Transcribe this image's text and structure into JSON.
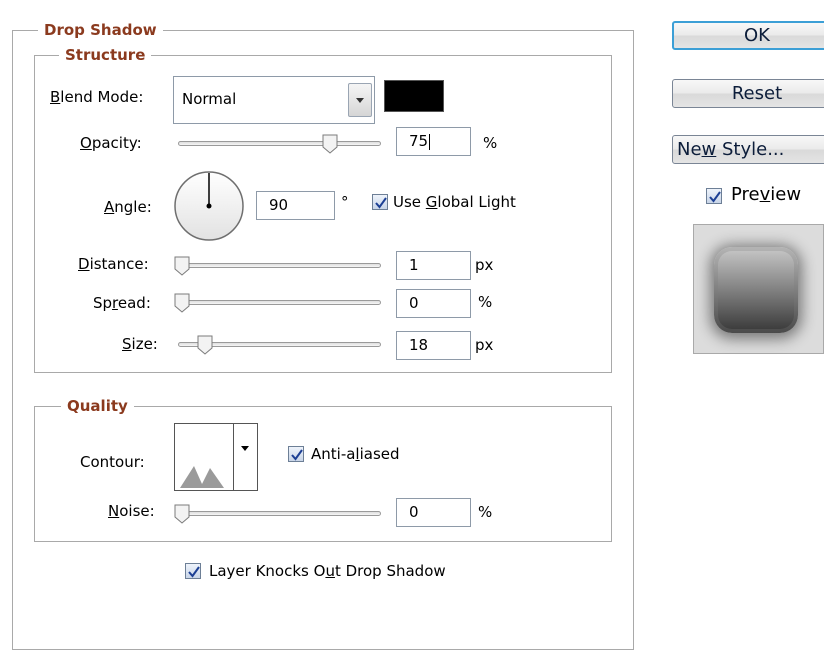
{
  "drop_shadow": {
    "title": "Drop Shadow",
    "structure": {
      "title": "Structure",
      "blend_mode_label": "Blend Mode:",
      "blend_mode_value": "Normal",
      "shadow_color": "#000000",
      "opacity_label": "Opacity:",
      "opacity_value": "75",
      "opacity_unit": "%",
      "opacity_fraction": 0.75,
      "angle_label": "Angle:",
      "angle_value": "90",
      "angle_unit": "°",
      "use_global_light_label": "Use Global Light",
      "use_global_light_checked": true,
      "distance_label": "Distance:",
      "distance_value": "1",
      "distance_unit": "px",
      "spread_label": "Spread:",
      "spread_value": "0",
      "spread_unit": "%",
      "size_label": "Size:",
      "size_value": "18",
      "size_unit": "px"
    },
    "quality": {
      "title": "Quality",
      "contour_label": "Contour:",
      "anti_aliased_label": "Anti-aliased",
      "anti_aliased_checked": true,
      "noise_label": "Noise:",
      "noise_value": "0",
      "noise_unit": "%"
    },
    "layer_knocks_out_label": "Layer Knocks Out Drop Shadow",
    "layer_knocks_out_checked": true
  },
  "buttons": {
    "ok": "OK",
    "reset": "Reset",
    "new_style": "New Style..."
  },
  "preview": {
    "label": "Preview",
    "checked": true
  },
  "colors": {
    "legend": "#8b3a1e",
    "default_button_border": "#3c9fd6"
  }
}
